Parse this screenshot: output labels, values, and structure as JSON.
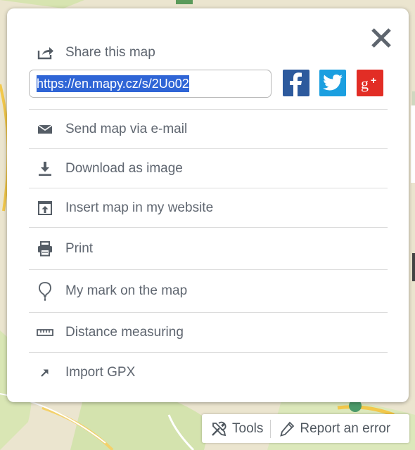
{
  "share": {
    "title": "Share this map",
    "url": "https://en.mapy.cz/s/2Uo02",
    "close_icon": "close-icon",
    "social": [
      {
        "name": "facebook",
        "icon": "facebook-icon",
        "color": "#2d5a9d"
      },
      {
        "name": "twitter",
        "icon": "twitter-icon",
        "color": "#1b9fe0"
      },
      {
        "name": "google-plus",
        "icon": "google-plus-icon",
        "color": "#e22d25"
      }
    ]
  },
  "menu": {
    "items": [
      {
        "label": "Send map via e-mail",
        "icon": "envelope-icon"
      },
      {
        "label": "Download as image",
        "icon": "download-icon"
      },
      {
        "label": "Insert map in my website",
        "icon": "embed-upload-icon"
      },
      {
        "label": "Print",
        "icon": "printer-icon"
      },
      {
        "label": "My mark on the map",
        "icon": "balloon-pin-icon"
      },
      {
        "label": "Distance measuring",
        "icon": "ruler-icon"
      },
      {
        "label": "Import GPX",
        "icon": "arrow-up-right-icon"
      }
    ]
  },
  "toolbar": {
    "tools_label": "Tools",
    "report_label": "Report an error"
  },
  "colors": {
    "text": "#5f6670",
    "icon": "#555d66",
    "divider": "#dcdcdc"
  }
}
